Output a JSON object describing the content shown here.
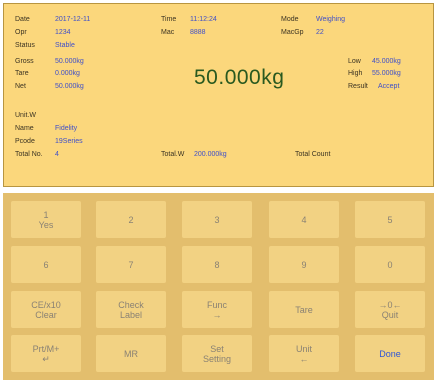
{
  "info": {
    "date_label": "Date",
    "date": "2017-12-11",
    "time_label": "Time",
    "time": "11:12:24",
    "mode_label": "Mode",
    "mode": "Weighing",
    "opr_label": "Opr",
    "opr": "1234",
    "mac_label": "Mac",
    "mac": "8888",
    "macgp_label": "MacGp",
    "macgp": "22",
    "status_label": "Status",
    "status": "Stable",
    "gross_label": "Gross",
    "gross": "50.000kg",
    "tare_label": "Tare",
    "tare": "0.000kg",
    "net_label": "Net",
    "net": "50.000kg",
    "weight_display": "50.000kg",
    "low_label": "Low",
    "low": "45.000kg",
    "high_label": "High",
    "high": "55.000kg",
    "result_label": "Result",
    "result": "Accept",
    "unitw_label": "Unit.W",
    "name_label": "Name",
    "name": "Fidelity",
    "pcode_label": "Pcode",
    "pcode": "19Series",
    "totalno_label": "Total No.",
    "totalno": "4",
    "totalw_label": "Total.W",
    "totalw": "200.000kg",
    "totalcount_label": "Total Count"
  },
  "keys": {
    "k1": {
      "line1": "1",
      "line2": "Yes"
    },
    "k2": "2",
    "k3": "3",
    "k4": "4",
    "k5": "5",
    "k6": "6",
    "k7": "7",
    "k8": "8",
    "k9": "9",
    "k0": "0",
    "clear": {
      "line1": "CE/x10",
      "line2": "Clear"
    },
    "check": {
      "line1": "Check",
      "line2": "Label"
    },
    "func": {
      "line1": "Func",
      "line2": "→"
    },
    "tare": "Tare",
    "quit": {
      "line1": "→0←",
      "line2": "Quit"
    },
    "prt": {
      "line1": "Prt/M+",
      "line2": "↵"
    },
    "mr": "MR",
    "set": {
      "line1": "Set",
      "line2": "Setting"
    },
    "unit": {
      "line1": "Unit",
      "line2": "←"
    },
    "done": "Done"
  },
  "colors": {
    "panel": "#fbd77c",
    "keypad": "#e3be6d",
    "value_blue": "#3f4fc9",
    "weight_green": "#29591f"
  }
}
